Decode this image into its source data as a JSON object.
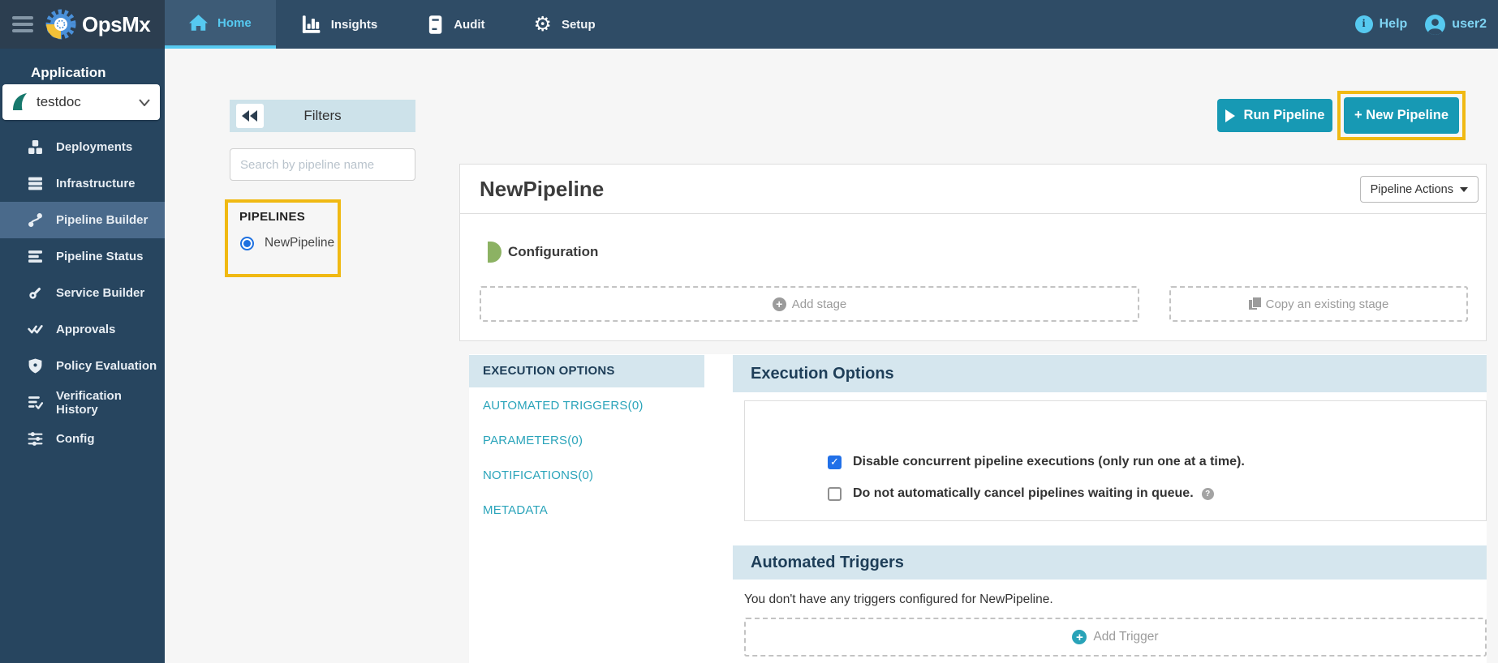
{
  "topbar": {
    "brand": "OpsMx",
    "tabs": [
      {
        "label": "Home",
        "active": true
      },
      {
        "label": "Insights",
        "active": false
      },
      {
        "label": "Audit",
        "active": false
      },
      {
        "label": "Setup",
        "active": false
      }
    ],
    "help_label": "Help",
    "username": "user2"
  },
  "sidebar": {
    "section_label": "Application",
    "application_selector": {
      "value": "testdoc"
    },
    "items": [
      {
        "label": "Deployments",
        "active": false
      },
      {
        "label": "Infrastructure",
        "active": false
      },
      {
        "label": "Pipeline Builder",
        "active": true
      },
      {
        "label": "Pipeline Status",
        "active": false
      },
      {
        "label": "Service Builder",
        "active": false
      },
      {
        "label": "Approvals",
        "active": false
      },
      {
        "label": "Policy Evaluation",
        "active": false
      },
      {
        "label": "Verification History",
        "active": false
      },
      {
        "label": "Config",
        "active": false
      }
    ]
  },
  "filters_panel": {
    "title": "Filters",
    "search_placeholder": "Search by pipeline name",
    "section_label": "PIPELINES",
    "pipelines": [
      {
        "name": "NewPipeline",
        "selected": true
      }
    ]
  },
  "header_actions": {
    "run_pipeline_label": "Run Pipeline",
    "new_pipeline_label": "+ New Pipeline"
  },
  "pipeline_card": {
    "title": "NewPipeline",
    "actions_button_label": "Pipeline Actions",
    "configuration_label": "Configuration",
    "add_stage_label": "Add stage",
    "copy_stage_label": "Copy an existing stage"
  },
  "config_nav": {
    "tabs": [
      {
        "label": "EXECUTION OPTIONS",
        "active": true
      },
      {
        "label": "AUTOMATED TRIGGERS(0)",
        "active": false
      },
      {
        "label": "PARAMETERS(0)",
        "active": false
      },
      {
        "label": "NOTIFICATIONS(0)",
        "active": false
      },
      {
        "label": "METADATA",
        "active": false
      }
    ]
  },
  "execution_options": {
    "title": "Execution Options",
    "options": [
      {
        "label": "Disable concurrent pipeline executions (only run one at a time).",
        "checked": true
      },
      {
        "label": "Do not automatically cancel pipelines waiting in queue.",
        "checked": false,
        "has_help_icon": true
      }
    ]
  },
  "automated_triggers": {
    "title": "Automated Triggers",
    "empty_message": "You don't have any triggers configured for NewPipeline.",
    "add_trigger_label": "Add Trigger"
  },
  "colors": {
    "topbar_accent_cyan": "#56c9f0",
    "button_teal": "#1799b4",
    "highlight_yellow": "#f0b913",
    "section_header_blue": "#d5e6ee",
    "link_teal": "#2aa4ba",
    "checkbox_blue": "#2170e8",
    "configuration_green": "#8cb263"
  }
}
